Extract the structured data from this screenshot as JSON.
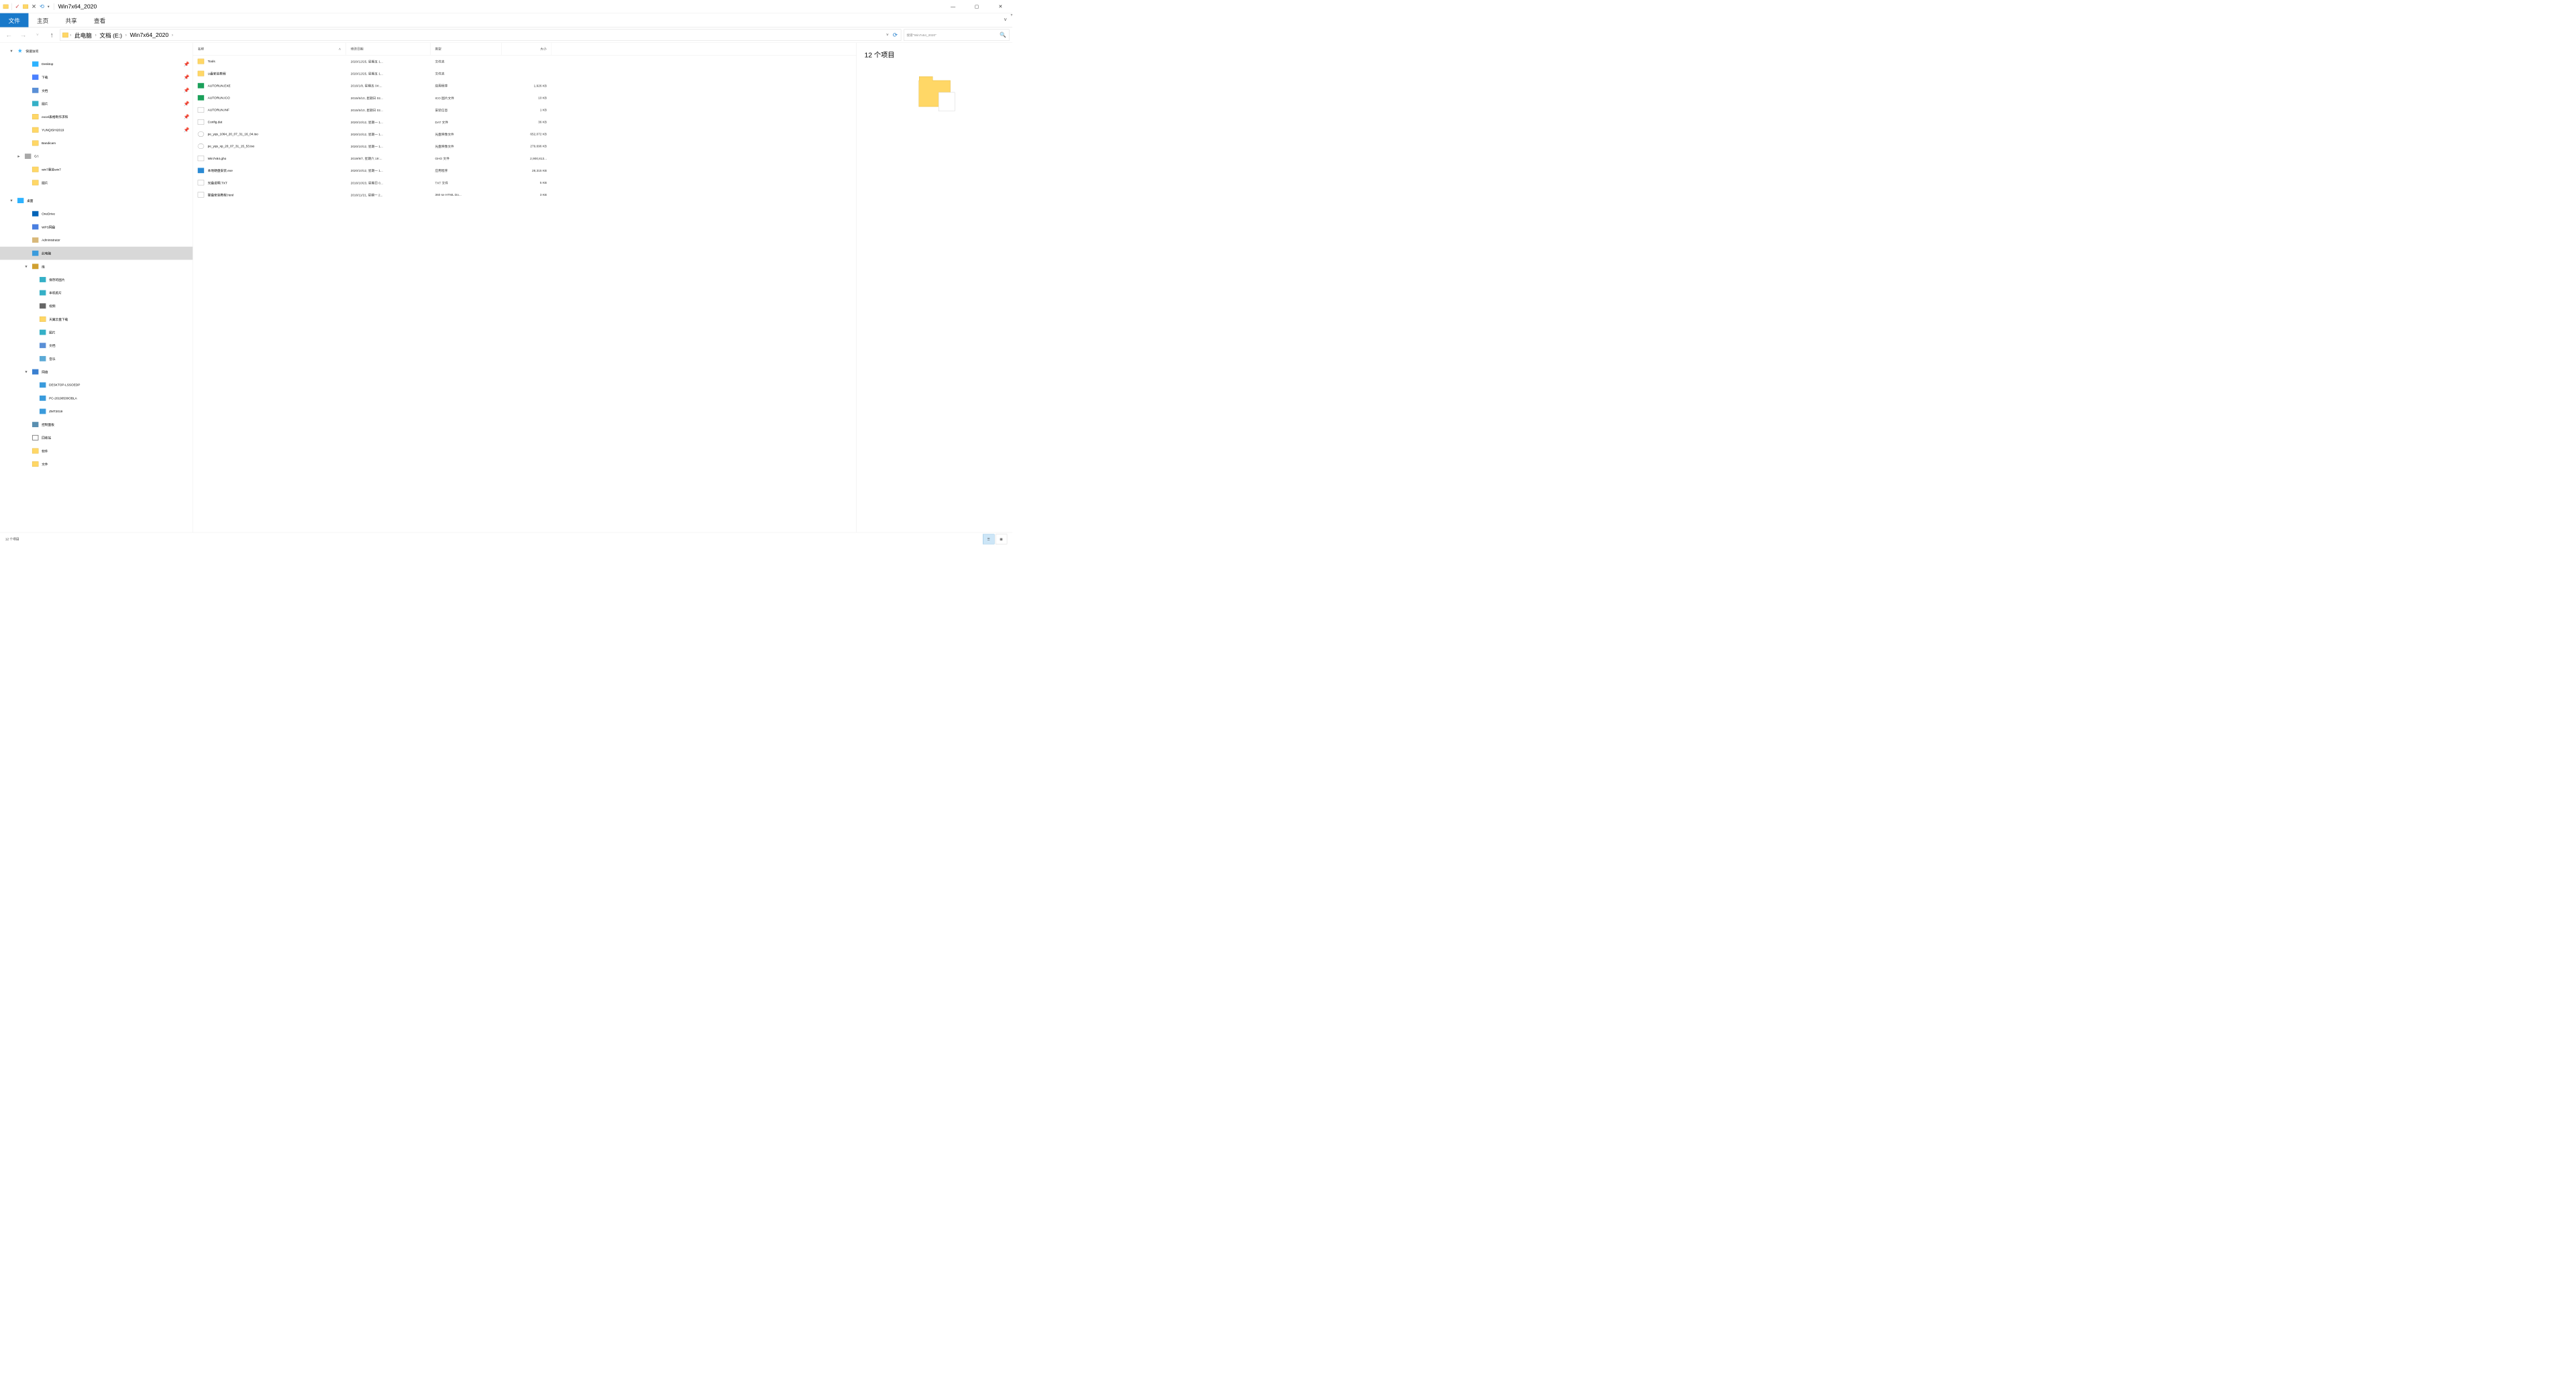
{
  "titlebar": {
    "title": "Win7x64_2020"
  },
  "ribbon": {
    "file": "文件",
    "home": "主页",
    "share": "共享",
    "view": "查看"
  },
  "breadcrumb": [
    "此电脑",
    "文档 (E:)",
    "Win7x64_2020"
  ],
  "search_placeholder": "搜索\"Win7x64_2020\"",
  "sidebar": {
    "quick": "快速访问",
    "items": [
      {
        "label": "Desktop",
        "pin": true,
        "ico": "ico-desk",
        "indent": 2
      },
      {
        "label": "下载",
        "pin": true,
        "ico": "ico-dl",
        "indent": 2
      },
      {
        "label": "文档",
        "pin": true,
        "ico": "ico-doc",
        "indent": 2
      },
      {
        "label": "图片",
        "pin": true,
        "ico": "ico-pic",
        "indent": 2
      },
      {
        "label": "excel表格制作求和",
        "pin": true,
        "ico": "ico-fold",
        "indent": 2
      },
      {
        "label": "YUNQISHI2019",
        "pin": true,
        "ico": "ico-fold",
        "indent": 2
      },
      {
        "label": "Bandicam",
        "pin": false,
        "ico": "ico-fold",
        "indent": 2
      },
      {
        "label": "G:\\",
        "pin": false,
        "ico": "ico-drive",
        "indent": 1,
        "chev": "▸"
      },
      {
        "label": "win7重装win7",
        "pin": false,
        "ico": "ico-fold",
        "indent": 2
      },
      {
        "label": "图片",
        "pin": false,
        "ico": "ico-fold",
        "indent": 2
      }
    ],
    "desktop": "桌面",
    "tree": [
      {
        "label": "OneDrive",
        "ico": "ico-cloud",
        "indent": 2
      },
      {
        "label": "WPS网盘",
        "ico": "ico-wps",
        "indent": 2
      },
      {
        "label": "Administrator",
        "ico": "ico-user",
        "indent": 2
      },
      {
        "label": "此电脑",
        "ico": "ico-pc",
        "indent": 2,
        "selected": true
      },
      {
        "label": "库",
        "ico": "ico-lib",
        "indent": 2,
        "chev": "▾"
      },
      {
        "label": "保存的图片",
        "ico": "ico-pic",
        "indent": 3
      },
      {
        "label": "本机照片",
        "ico": "ico-pic",
        "indent": 3
      },
      {
        "label": "视频",
        "ico": "ico-vid",
        "indent": 3
      },
      {
        "label": "天翼云盘下载",
        "ico": "ico-fold",
        "indent": 3
      },
      {
        "label": "图片",
        "ico": "ico-pic",
        "indent": 3
      },
      {
        "label": "文档",
        "ico": "ico-doc",
        "indent": 3
      },
      {
        "label": "音乐",
        "ico": "ico-music",
        "indent": 3
      },
      {
        "label": "网络",
        "ico": "ico-net",
        "indent": 2,
        "chev": "▾"
      },
      {
        "label": "DESKTOP-LSSOEDP",
        "ico": "ico-pc",
        "indent": 3
      },
      {
        "label": "PC-20190530OBLA",
        "ico": "ico-pc",
        "indent": 3
      },
      {
        "label": "ZMT2019",
        "ico": "ico-pc",
        "indent": 3
      },
      {
        "label": "控制面板",
        "ico": "ico-cp",
        "indent": 2
      },
      {
        "label": "回收站",
        "ico": "ico-recycle",
        "indent": 2
      },
      {
        "label": "软件",
        "ico": "ico-fold",
        "indent": 2
      },
      {
        "label": "文件",
        "ico": "ico-fold",
        "indent": 2
      }
    ]
  },
  "columns": {
    "name": "名称",
    "date": "修改日期",
    "type": "类型",
    "size": "大小"
  },
  "files": [
    {
      "name": "Tools",
      "date": "2020/12/25, 星期五 1...",
      "type": "文件夹",
      "size": "",
      "ico": "fold"
    },
    {
      "name": "U盘安装教程",
      "date": "2020/12/25, 星期五 1...",
      "type": "文件夹",
      "size": "",
      "ico": "fold"
    },
    {
      "name": "AUTORUN.EXE",
      "date": "2016/1/8, 星期五 04:...",
      "type": "应用程序",
      "size": "1,926 KB",
      "ico": "exe"
    },
    {
      "name": "AUTORUN.ICO",
      "date": "2015/5/10, 星期日 02...",
      "type": "ICO 图片文件",
      "size": "10 KB",
      "ico": "ico"
    },
    {
      "name": "AUTORUN.INF",
      "date": "2015/5/10, 星期日 02...",
      "type": "安装信息",
      "size": "1 KB",
      "ico": "inf"
    },
    {
      "name": "Config.dat",
      "date": "2020/10/12, 星期一 1...",
      "type": "DAT 文件",
      "size": "36 KB",
      "ico": "dat"
    },
    {
      "name": "pe_yqs_1064_20_07_31_16_04.iso",
      "date": "2020/10/12, 星期一 1...",
      "type": "光盘映像文件",
      "size": "652,072 KB",
      "ico": "iso"
    },
    {
      "name": "pe_yqs_xp_20_07_31_15_53.iso",
      "date": "2020/10/12, 星期一 1...",
      "type": "光盘映像文件",
      "size": "279,696 KB",
      "ico": "iso"
    },
    {
      "name": "Win7x64.gho",
      "date": "2019/9/7, 星期六 19:...",
      "type": "GHO 文件",
      "size": "2,900,813...",
      "ico": "gho"
    },
    {
      "name": "本地硬盘安装.exe",
      "date": "2020/10/12, 星期一 1...",
      "type": "应用程序",
      "size": "28,315 KB",
      "ico": "exe2"
    },
    {
      "name": "光盘说明.TXT",
      "date": "2016/10/23, 星期日 0...",
      "type": "TXT 文件",
      "size": "5 KB",
      "ico": "txt"
    },
    {
      "name": "硬盘安装教程.html",
      "date": "2016/11/21, 星期一 2...",
      "type": "360 se HTML Do...",
      "size": "3 KB",
      "ico": "html"
    }
  ],
  "preview": {
    "title": "12 个项目"
  },
  "status": {
    "count": "12 个项目"
  }
}
